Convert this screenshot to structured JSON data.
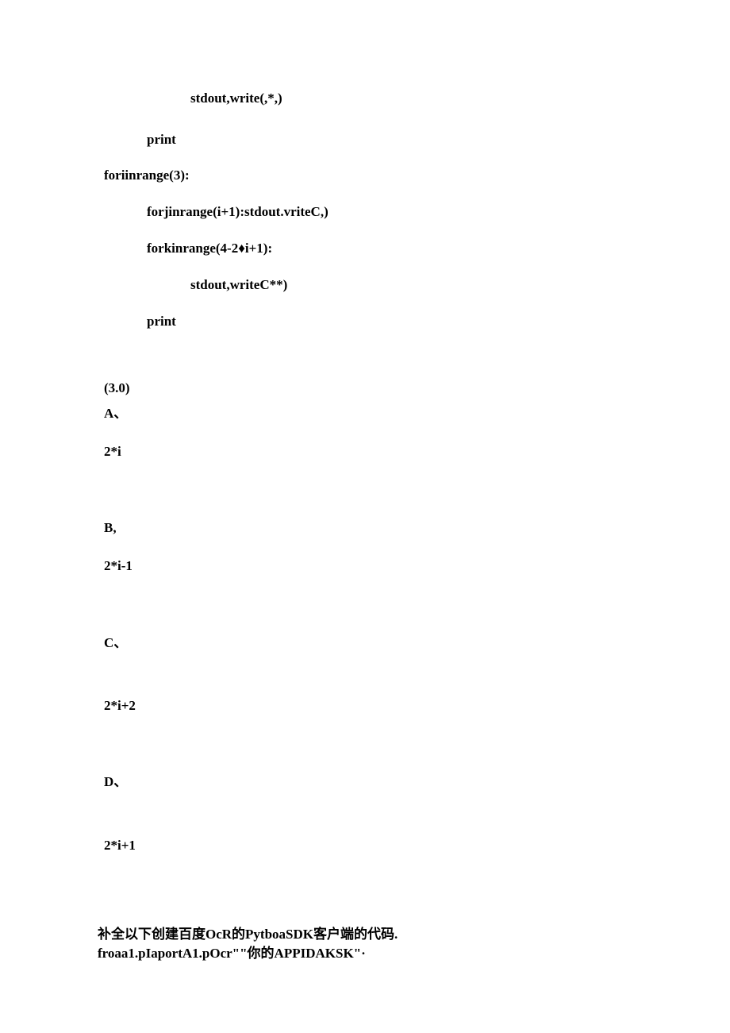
{
  "code": {
    "l1": "stdout,write(,*,)",
    "l2": "print",
    "l3": "foriinrange(3):",
    "l4": "forjinrange(i+1):stdout.vriteC,)",
    "l5": "forkinrange(4-2♦i+1):",
    "l6": "stdout,writeC**)",
    "l7": "print"
  },
  "question": {
    "header": "(3.0)",
    "opt_a_label": "A、",
    "opt_a_value": "2*i",
    "opt_b_label": "B,",
    "opt_b_value": "2*i-1",
    "opt_c_label": "C、",
    "opt_c_value": "2*i+2",
    "opt_d_label": "D、",
    "opt_d_value": "2*i+1"
  },
  "footer": {
    "line1": "补全以下创建百度OcR的PytboaSDK客户端的代码.",
    "line2": "froaa1.pIaportA1.pOcr\"\"你的APPIDAKSK\"·"
  }
}
